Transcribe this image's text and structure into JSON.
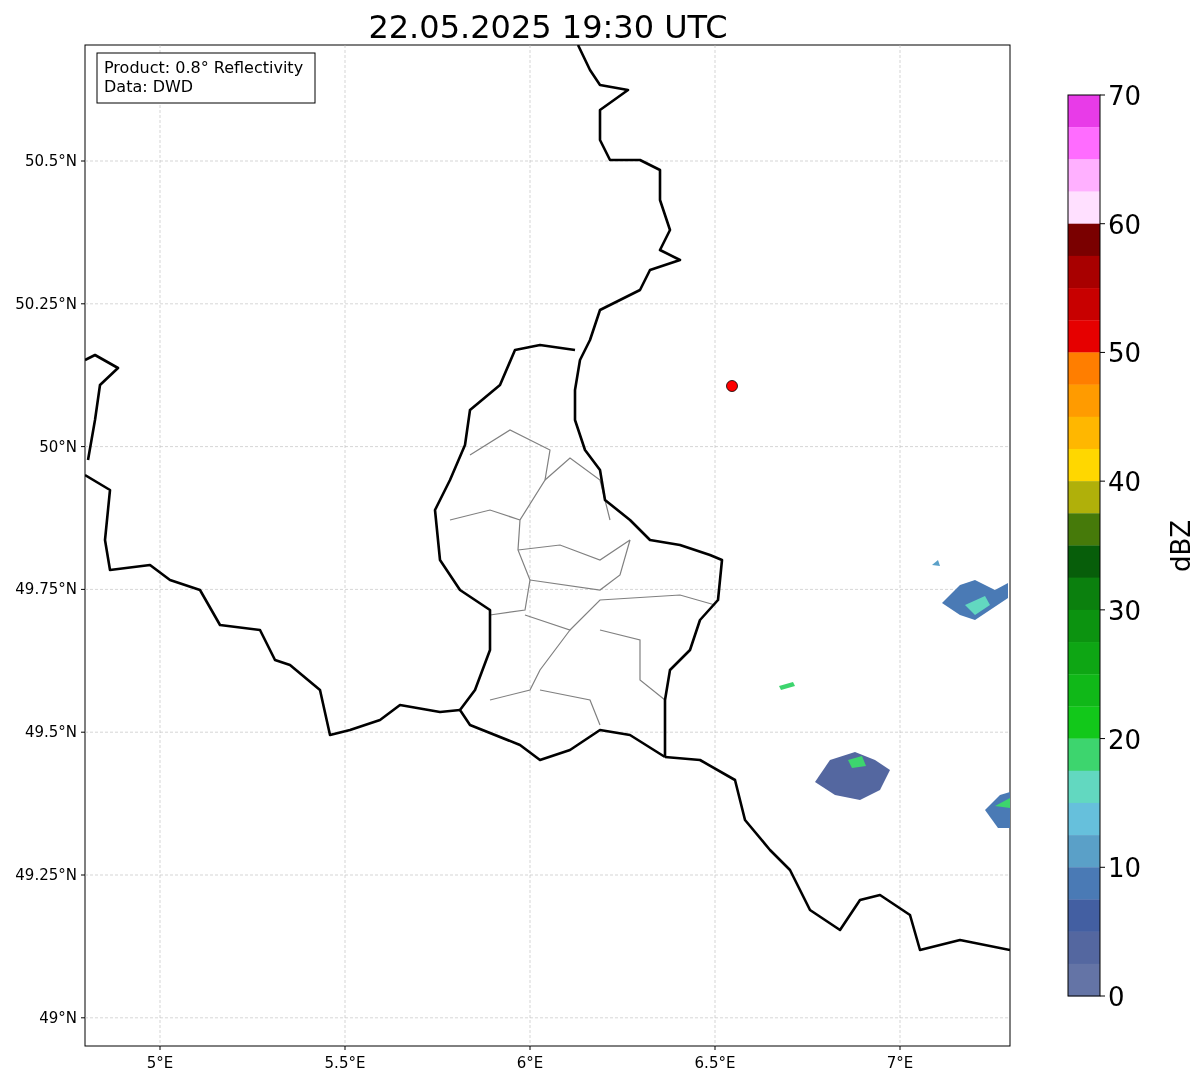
{
  "title": "22.05.2025 19:30 UTC",
  "info_box": {
    "lines": [
      "Product: 0.8° Reflectivity",
      "Data: DWD"
    ]
  },
  "map": {
    "xticks": [
      "5°E",
      "5.5°E",
      "6°E",
      "6.5°E",
      "7°E"
    ],
    "yticks": [
      "50.5°N",
      "50.25°N",
      "50°N",
      "49.75°N",
      "49.5°N",
      "49.25°N",
      "49°N"
    ]
  },
  "colorbar": {
    "label": "dBZ",
    "ticks": [
      "70",
      "60",
      "50",
      "40",
      "30",
      "20",
      "10",
      "0"
    ],
    "bins": [
      {
        "color": "#e83be8"
      },
      {
        "color": "#ff6cff"
      },
      {
        "color": "#ffb0ff"
      },
      {
        "color": "#ffe0ff"
      },
      {
        "color": "#7a0000"
      },
      {
        "color": "#a80000"
      },
      {
        "color": "#c80000"
      },
      {
        "color": "#e60000"
      },
      {
        "color": "#ff7e00"
      },
      {
        "color": "#ff9b00"
      },
      {
        "color": "#ffb700"
      },
      {
        "color": "#ffd700"
      },
      {
        "color": "#b0b00a"
      },
      {
        "color": "#467a0a"
      },
      {
        "color": "#075e0a"
      },
      {
        "color": "#0b800e"
      },
      {
        "color": "#0c9310"
      },
      {
        "color": "#0ea614"
      },
      {
        "color": "#10b818"
      },
      {
        "color": "#12c81a"
      },
      {
        "color": "#3dd56e"
      },
      {
        "color": "#62d8c0"
      },
      {
        "color": "#66c0dc"
      },
      {
        "color": "#5aa0c8"
      },
      {
        "color": "#4a7ab5"
      },
      {
        "color": "#435fa2"
      },
      {
        "color": "#5467a0"
      },
      {
        "color": "#6474a6"
      }
    ]
  }
}
